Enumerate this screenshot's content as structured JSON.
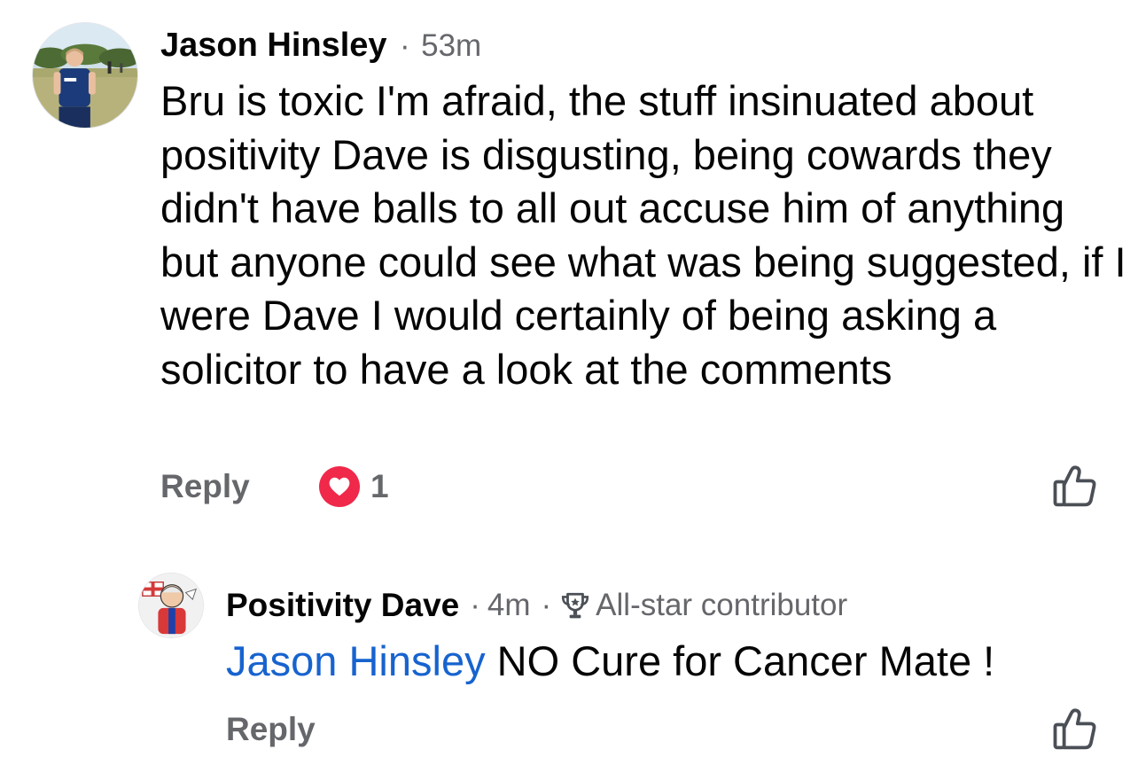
{
  "main_comment": {
    "author": "Jason Hinsley",
    "separator": "·",
    "time": "53m",
    "text": "Bru is toxic I'm afraid, the stuff insinuated about positivity Dave is disgusting, being cowards they didn't have balls to all out accuse him of anything but anyone could see what was being suggested, if I were Dave I would certainly of being asking a solicitor to have a look at the comments",
    "reply_label": "Reply",
    "reaction_icon": "heart-icon",
    "reaction_count": "1",
    "like_icon": "thumbs-up-icon"
  },
  "reply_comment": {
    "author": "Positivity Dave",
    "separator": "·",
    "time": "4m",
    "separator2": "·",
    "badge_icon": "trophy-icon",
    "badge_label": "All-star contributor",
    "mention": "Jason Hinsley",
    "text": "NO Cure for Cancer Mate !",
    "reply_label": "Reply",
    "like_icon": "thumbs-up-icon"
  },
  "colors": {
    "text": "#050505",
    "secondary": "#65676b",
    "mention": "#1763cf",
    "love_reaction": "#f0284a"
  }
}
